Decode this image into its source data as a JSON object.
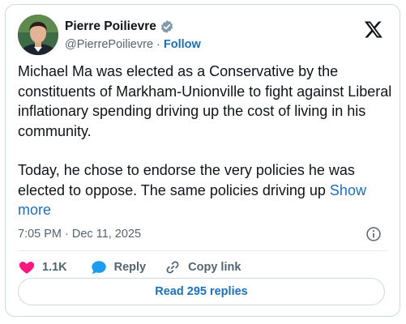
{
  "author": {
    "display_name": "Pierre Poilievre",
    "handle": "@PierrePoilievre",
    "separator": "·",
    "follow_label": "Follow"
  },
  "tweet": {
    "paragraph_1": "Michael Ma was elected as a Conservative by the constituents of Markham-Unionville to fight against Liberal inflationary spending driving up the cost of living in his community.",
    "paragraph_2": "Today, he chose to endorse the very policies he was elected to oppose. The same policies driving up",
    "show_more_label": "Show more",
    "timestamp": "7:05 PM · Dec 11, 2025"
  },
  "actions": {
    "like_count": "1.1K",
    "reply_label": "Reply",
    "copy_link_label": "Copy link"
  },
  "read_replies_label": "Read 295 replies",
  "icons": {
    "verified": "verified-badge-icon",
    "logo": "x-logo-icon",
    "info": "info-icon",
    "like": "heart-icon",
    "reply": "speech-bubble-icon",
    "copy": "link-icon"
  },
  "colors": {
    "link_blue": "#1d6fb8",
    "verified_gray": "#829aab",
    "like_pink": "#f91880",
    "reply_blue": "#1d9bf0",
    "text": "#0f1419",
    "secondary": "#536471",
    "border": "#cfd9de"
  }
}
